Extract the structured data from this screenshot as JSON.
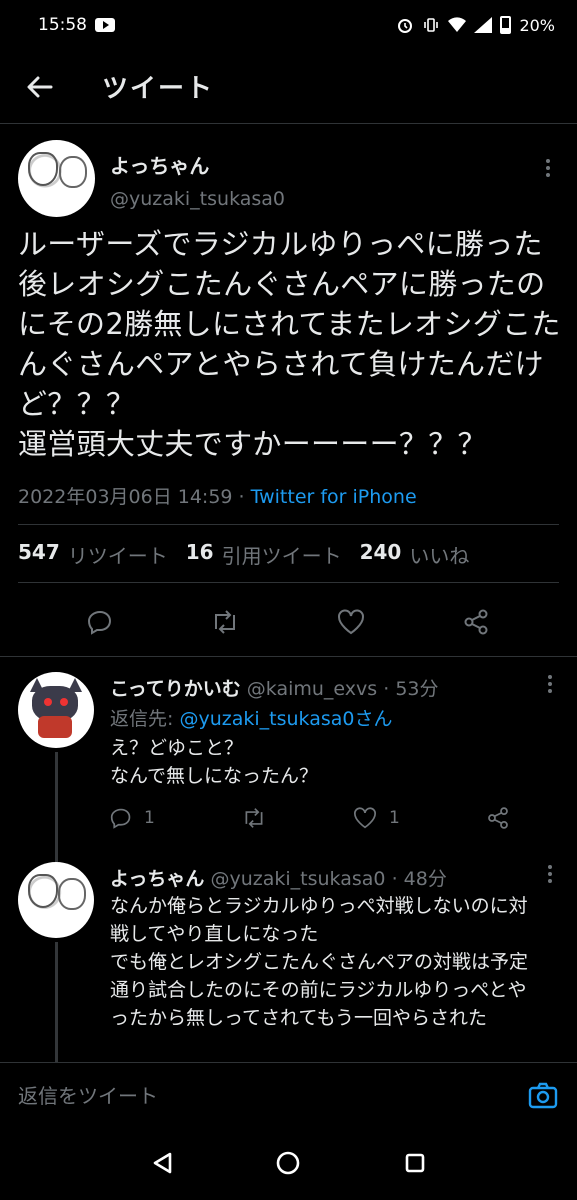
{
  "status_bar": {
    "time": "15:58",
    "battery": "20%"
  },
  "header": {
    "title": "ツイート"
  },
  "main_tweet": {
    "name": "よっちゃん",
    "handle": "@yuzaki_tsukasa0",
    "text": "ルーザーズでラジカルゆりっペに勝った後レオシグこたんぐさんペアに勝ったのにその2勝無しにされてまたレオシグこたんぐさんペアとやらされて負けたんだけど？？？\n運営頭大丈夫ですかーーーー？？？",
    "timestamp": "2022年03月06日 14:59",
    "separator": " · ",
    "source": "Twitter for iPhone",
    "retweets": "547",
    "retweets_label": "リツイート",
    "quotes": "16",
    "quotes_label": "引用ツイート",
    "likes": "240",
    "likes_label": "いいね"
  },
  "replies": [
    {
      "name": "こってりかいむ",
      "handle": "@kaimu_exvs",
      "time": "53分",
      "reply_to_label": "返信先: ",
      "reply_to_handle": "@yuzaki_tsukasa0さん",
      "text": "え？どゆこと？\nなんで無しになったん？",
      "reply_count": "1",
      "like_count": "1"
    },
    {
      "name": "よっちゃん",
      "handle": "@yuzaki_tsukasa0",
      "time": "48分",
      "text": "なんか俺らとラジカルゆりっぺ対戦しないのに対戦してやり直しになった\nでも俺とレオシグこたんぐさんペアの対戦は予定通り試合したのにその前にラジカルゆりっぺとやったから無しってされてもう一回やらされた"
    }
  ],
  "compose": {
    "placeholder": "返信をツイート"
  },
  "colors": {
    "accent": "#1d9bf0",
    "background": "#000000",
    "muted": "#71767b"
  }
}
